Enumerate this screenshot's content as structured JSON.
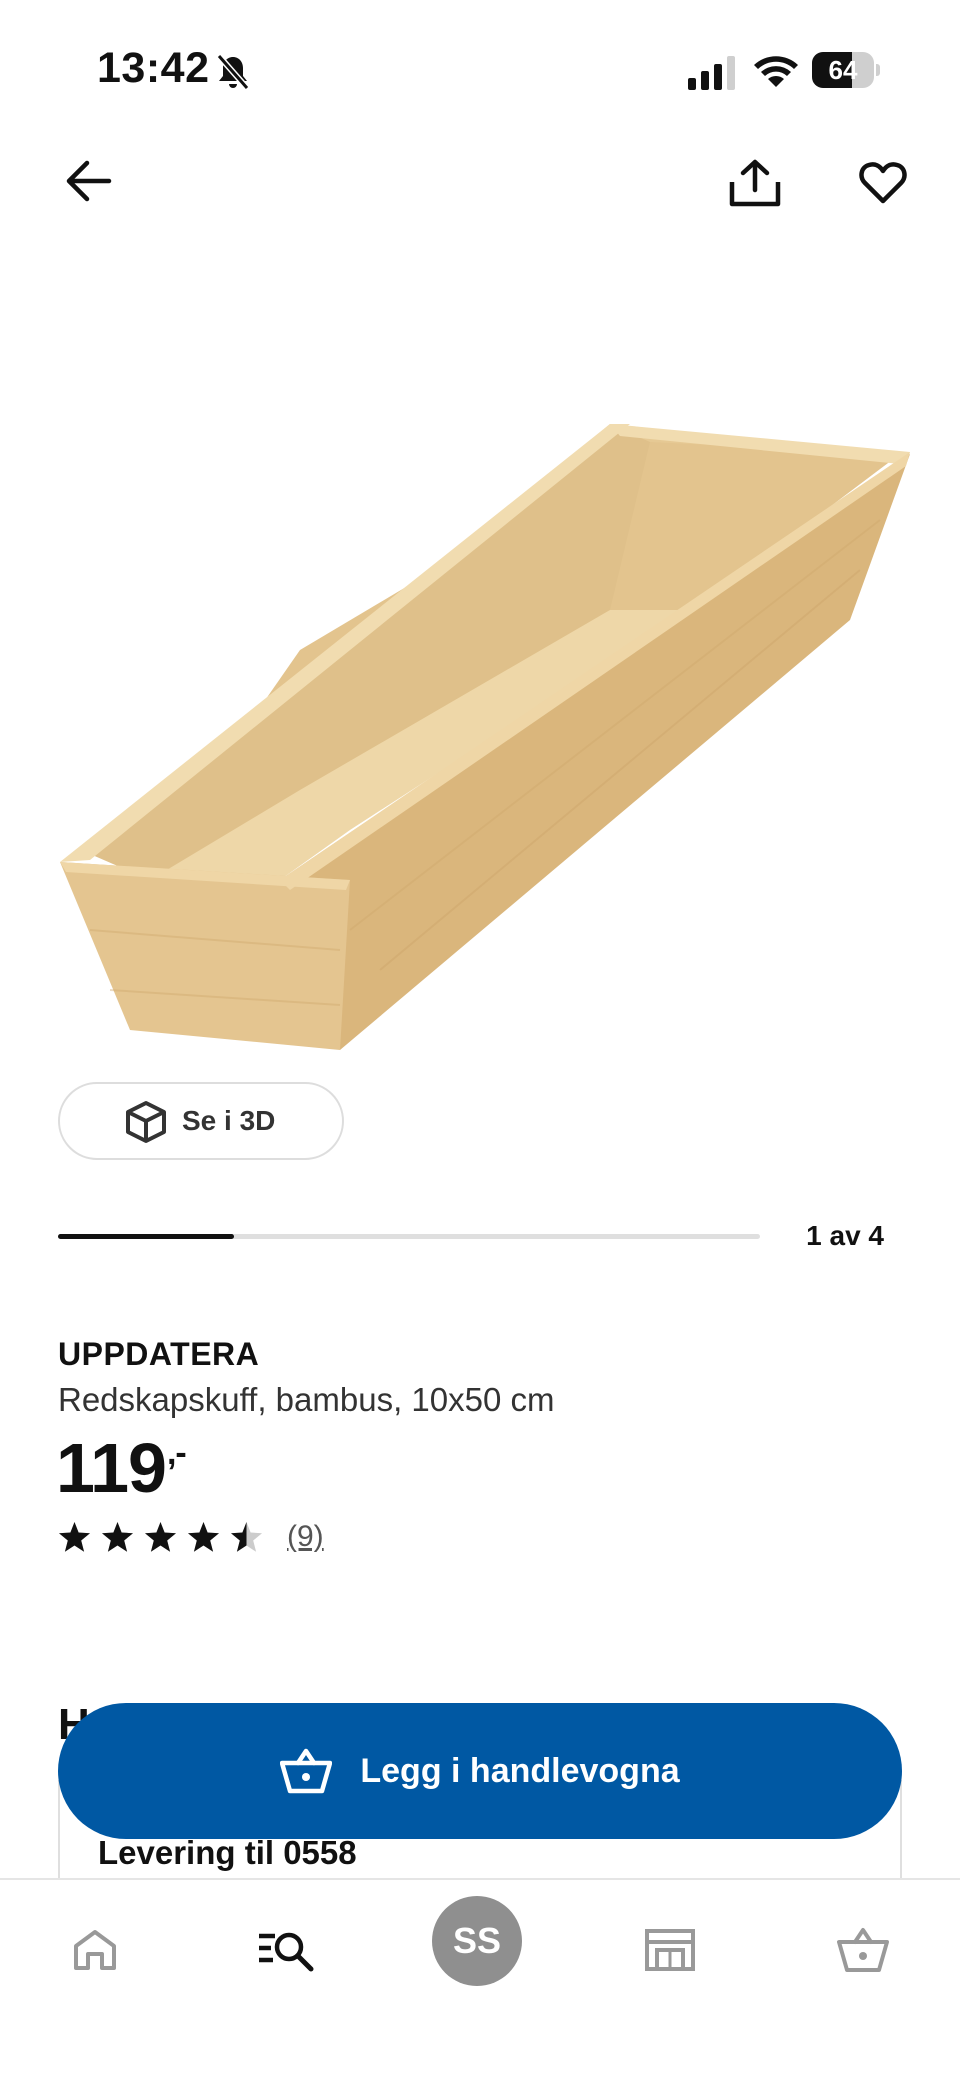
{
  "status_bar": {
    "time": "13:42",
    "battery": "64",
    "battery_level": 0.64
  },
  "icons": {
    "back": "arrow-left-icon",
    "share": "share-icon",
    "favourite": "heart-icon",
    "view_3d": "cube-icon",
    "cart": "basket-icon"
  },
  "gallery": {
    "view_3d_label": "Se i 3D",
    "position_text": "1 av 4",
    "position": 1,
    "total": 4
  },
  "product": {
    "name": "UPPDATERA",
    "description": "Redskapskuff, bambus, 10x50 cm",
    "price": "119",
    "price_suffix": ",-",
    "rating": 4.5,
    "max_rating": 5,
    "review_count": "(9)"
  },
  "section": {
    "peek_heading": "H",
    "delivery_text": "Levering til 0558"
  },
  "actions": {
    "add_to_cart": "Legg i handlevogna"
  },
  "bottom_nav": {
    "profile_initials": "SS"
  },
  "colors": {
    "primary_blue": "#0058a3",
    "profile_grey": "#8f8f8f",
    "wood_light": "#e9cf9f",
    "wood_dark": "#d8b47b"
  }
}
